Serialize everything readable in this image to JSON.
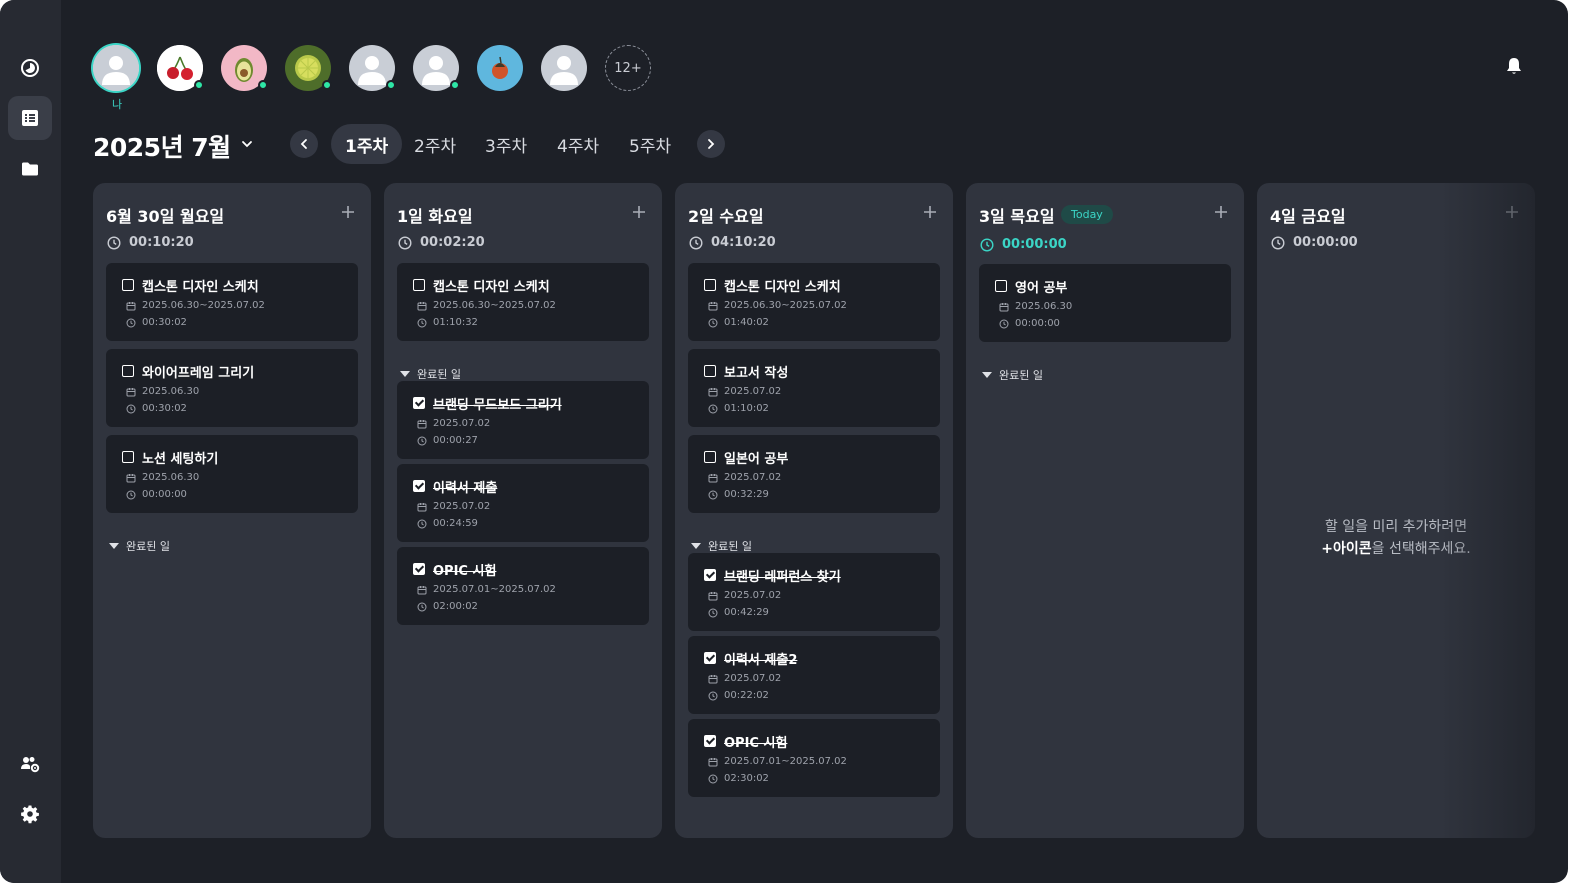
{
  "sidebar": {
    "items": [
      {
        "name": "timer-icon"
      },
      {
        "name": "list-icon",
        "active": true
      },
      {
        "name": "folder-icon"
      },
      {
        "name": "team-settings-icon"
      },
      {
        "name": "gear-icon"
      }
    ]
  },
  "header": {
    "me_label": "나",
    "more_count": "12+",
    "month_title": "2025년 7월",
    "weeks": [
      "1주차",
      "2주차",
      "3주차",
      "4주차",
      "5주차"
    ],
    "active_week": 0
  },
  "colors": {
    "accent": "#3bd5c6",
    "online": "#2ee6a6",
    "column_bg": "#30343e",
    "card_bg": "#1c1f26"
  },
  "columns": [
    {
      "title": "6월 30일 월요일",
      "time": "00:10:20",
      "tasks": [
        {
          "title": "캡스톤 디자인 스케치",
          "date": "2025.06.30~2025.07.02",
          "time": "00:30:02"
        },
        {
          "title": "와이어프레임 그리기",
          "date": "2025.06.30",
          "time": "00:30:02"
        },
        {
          "title": "노션 세팅하기",
          "date": "2025.06.30",
          "time": "00:00:00"
        }
      ],
      "done_label": "완료된 일",
      "done": []
    },
    {
      "title": "1일 화요일",
      "time": "00:02:20",
      "tasks": [
        {
          "title": "캡스톤 디자인 스케치",
          "date": "2025.06.30~2025.07.02",
          "time": "01:10:32"
        }
      ],
      "done_label": "완료된 일",
      "done": [
        {
          "title": "브랜딩 무드보드 그리기",
          "date": "2025.07.02",
          "time": "00:00:27"
        },
        {
          "title": "이력서 제출",
          "date": "2025.07.02",
          "time": "00:24:59"
        },
        {
          "title": "OPIC 시험",
          "date": "2025.07.01~2025.07.02",
          "time": "02:00:02"
        }
      ]
    },
    {
      "title": "2일 수요일",
      "time": "04:10:20",
      "tasks": [
        {
          "title": "캡스톤 디자인 스케치",
          "date": "2025.06.30~2025.07.02",
          "time": "01:40:02"
        },
        {
          "title": "보고서 작성",
          "date": "2025.07.02",
          "time": "01:10:02"
        },
        {
          "title": "일본어 공부",
          "date": "2025.07.02",
          "time": "00:32:29"
        }
      ],
      "done_label": "완료된 일",
      "done": [
        {
          "title": "브랜딩 레퍼런스 찾기",
          "date": "2025.07.02",
          "time": "00:42:29"
        },
        {
          "title": "이력서 제출2",
          "date": "2025.07.02",
          "time": "00:22:02"
        },
        {
          "title": "OPIC 시험",
          "date": "2025.07.01~2025.07.02",
          "time": "02:30:02"
        }
      ]
    },
    {
      "title": "3일 목요일",
      "badge": "Today",
      "time": "00:00:00",
      "tasks": [
        {
          "title": "영어 공부",
          "date": "2025.06.30",
          "time": "00:00:00"
        }
      ],
      "done_label": "완료된 일",
      "done": []
    },
    {
      "title": "4일 금요일",
      "time": "00:00:00",
      "tasks": [],
      "done": [],
      "empty_hint_line1": "할 일을 미리 추가하려면",
      "empty_hint_plus": "+아이콘",
      "empty_hint_line2": "을 선택해주세요."
    }
  ]
}
